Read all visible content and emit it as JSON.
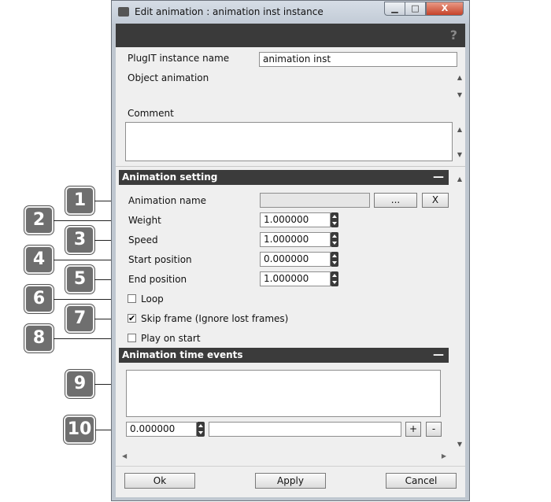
{
  "window": {
    "title": "Edit animation : animation inst instance",
    "min": "▁",
    "max": "□",
    "close": "X"
  },
  "help_icon": "?",
  "header": {
    "plugit_instance_name_label": "PlugIT instance name",
    "plugit_instance_name_value": "animation inst",
    "object_animation_label": "Object animation",
    "comment_label": "Comment"
  },
  "animation_setting": {
    "title": "Animation setting",
    "collapse": "—",
    "animation_name_label": "Animation name",
    "animation_name_value": "",
    "browse_label": "...",
    "clear_label": "X",
    "weight_label": "Weight",
    "weight_value": "1.000000",
    "speed_label": "Speed",
    "speed_value": "1.000000",
    "start_position_label": "Start position",
    "start_position_value": "0.000000",
    "end_position_label": "End position",
    "end_position_value": "1.000000",
    "loop_label": "Loop",
    "loop_checked": false,
    "skip_frame_label": "Skip frame (Ignore lost frames)",
    "skip_frame_checked": true,
    "play_on_start_label": "Play on start",
    "play_on_start_checked": false
  },
  "time_events": {
    "title": "Animation time events",
    "collapse": "—",
    "time_value": "0.000000",
    "event_value": "",
    "add_label": "+",
    "remove_label": "-"
  },
  "footer": {
    "ok_label": "Ok",
    "apply_label": "Apply",
    "cancel_label": "Cancel"
  },
  "callouts": [
    "1",
    "2",
    "3",
    "4",
    "5",
    "6",
    "7",
    "8",
    "9",
    "10"
  ],
  "glyphs": {
    "check": "✔",
    "up": "▲",
    "down": "▼",
    "left": "◀",
    "right": "▶"
  }
}
